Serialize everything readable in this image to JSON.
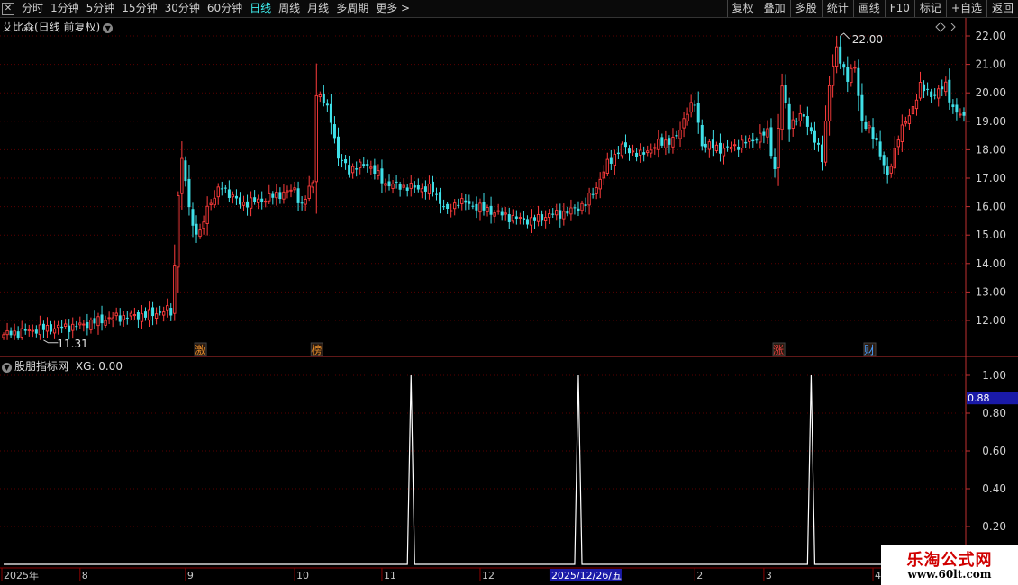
{
  "toolbar": {
    "left": [
      "分时",
      "1分钟",
      "5分钟",
      "15分钟",
      "30分钟",
      "60分钟",
      "日线",
      "周线",
      "月线",
      "多周期",
      "更多 >"
    ],
    "active": "日线",
    "right": [
      "复权",
      "叠加",
      "多股",
      "统计",
      "画线",
      "F10",
      "标记",
      "+自选",
      "返回"
    ]
  },
  "main_panel": {
    "title": "艾比森(日线 前复权)",
    "high_label": "22.00",
    "low_label": "11.31",
    "events": [
      {
        "label": "激",
        "date_index": 54,
        "color": "#e08a2a"
      },
      {
        "label": "榜",
        "date_index": 86,
        "color": "#e08a2a"
      },
      {
        "label": "涨",
        "date_index": 213,
        "color": "#e04040"
      },
      {
        "label": "财",
        "date_index": 238,
        "color": "#4aa0ff"
      }
    ]
  },
  "indicator_panel": {
    "title": "股朋指标网",
    "xg_label": "XG:",
    "xg_value": "0.00",
    "cursor_value": "0.88"
  },
  "date_axis": {
    "labels": [
      {
        "text": "2025年",
        "index": 0
      },
      {
        "text": "8",
        "index": 21
      },
      {
        "text": "9",
        "index": 50
      },
      {
        "text": "10",
        "index": 80
      },
      {
        "text": "11",
        "index": 104
      },
      {
        "text": "12",
        "index": 131
      },
      {
        "text": "2",
        "index": 190
      },
      {
        "text": "3",
        "index": 209
      },
      {
        "text": "4",
        "index": 239
      }
    ],
    "highlight": {
      "text": "2025/12/26/五",
      "index": 157
    }
  },
  "watermark": {
    "title": "乐淘公式网",
    "url": "www.60lt.com"
  },
  "chart_data": [
    {
      "type": "candlestick",
      "x_axis": "trading day index",
      "ylim": [
        11.0,
        22.4
      ],
      "y_ticks": [
        12.0,
        13.0,
        14.0,
        15.0,
        16.0,
        17.0,
        18.0,
        19.0,
        20.0,
        21.0,
        22.0
      ],
      "y_tick_labels": [
        "12.00",
        "13.00",
        "14.00",
        "15.00",
        "16.00",
        "17.00",
        "18.00",
        "19.00",
        "20.00",
        "21.00",
        "22.00"
      ],
      "grid": true,
      "colors": {
        "up": "#ff3c3c",
        "down": "#3fe0e8"
      },
      "close_anchors": [
        [
          0,
          11.5
        ],
        [
          10,
          11.7
        ],
        [
          20,
          11.8
        ],
        [
          30,
          12.1
        ],
        [
          40,
          12.2
        ],
        [
          45,
          12.35
        ],
        [
          46,
          12.3
        ],
        [
          47,
          13.9
        ],
        [
          48,
          16.5
        ],
        [
          49,
          17.6
        ],
        [
          52,
          15.3
        ],
        [
          54,
          15.0
        ],
        [
          56,
          16.0
        ],
        [
          60,
          16.7
        ],
        [
          65,
          16.1
        ],
        [
          70,
          16.2
        ],
        [
          75,
          16.4
        ],
        [
          80,
          16.6
        ],
        [
          82,
          16.0
        ],
        [
          85,
          16.9
        ],
        [
          86,
          20.0
        ],
        [
          88,
          19.7
        ],
        [
          90,
          19.1
        ],
        [
          92,
          17.7
        ],
        [
          95,
          17.3
        ],
        [
          100,
          17.5
        ],
        [
          105,
          16.8
        ],
        [
          110,
          16.7
        ],
        [
          118,
          16.6
        ],
        [
          122,
          15.8
        ],
        [
          125,
          16.2
        ],
        [
          130,
          16.0
        ],
        [
          135,
          15.8
        ],
        [
          140,
          15.6
        ],
        [
          145,
          15.5
        ],
        [
          150,
          15.7
        ],
        [
          155,
          15.8
        ],
        [
          160,
          16.1
        ],
        [
          163,
          16.7
        ],
        [
          166,
          17.5
        ],
        [
          170,
          18.1
        ],
        [
          175,
          17.8
        ],
        [
          180,
          18.2
        ],
        [
          185,
          18.4
        ],
        [
          188,
          19.4
        ],
        [
          190,
          19.6
        ],
        [
          192,
          18.2
        ],
        [
          198,
          18.0
        ],
        [
          205,
          18.3
        ],
        [
          210,
          18.6
        ],
        [
          212,
          17.3
        ],
        [
          214,
          20.2
        ],
        [
          216,
          18.9
        ],
        [
          220,
          19.2
        ],
        [
          225,
          17.7
        ],
        [
          227,
          20.3
        ],
        [
          229,
          21.5
        ],
        [
          232,
          20.5
        ],
        [
          234,
          20.9
        ],
        [
          236,
          19.0
        ],
        [
          240,
          18.3
        ],
        [
          243,
          17.0
        ],
        [
          246,
          18.5
        ],
        [
          249,
          19.2
        ],
        [
          252,
          20.2
        ],
        [
          256,
          19.9
        ],
        [
          259,
          20.3
        ],
        [
          261,
          19.4
        ],
        [
          263,
          19.2
        ]
      ],
      "high": 22.0,
      "low": 11.31
    },
    {
      "type": "line",
      "name": "XG",
      "ylim": [
        0,
        1.05
      ],
      "y_ticks": [
        0.2,
        0.4,
        0.6,
        0.8,
        1.0
      ],
      "y_tick_labels": [
        "0.20",
        "0.40",
        "0.60",
        "0.80",
        "1.00"
      ],
      "signal_indices": [
        112,
        158,
        222
      ],
      "signal_value": 1.0,
      "base_value": 0.0,
      "color": "#ffffff"
    }
  ]
}
